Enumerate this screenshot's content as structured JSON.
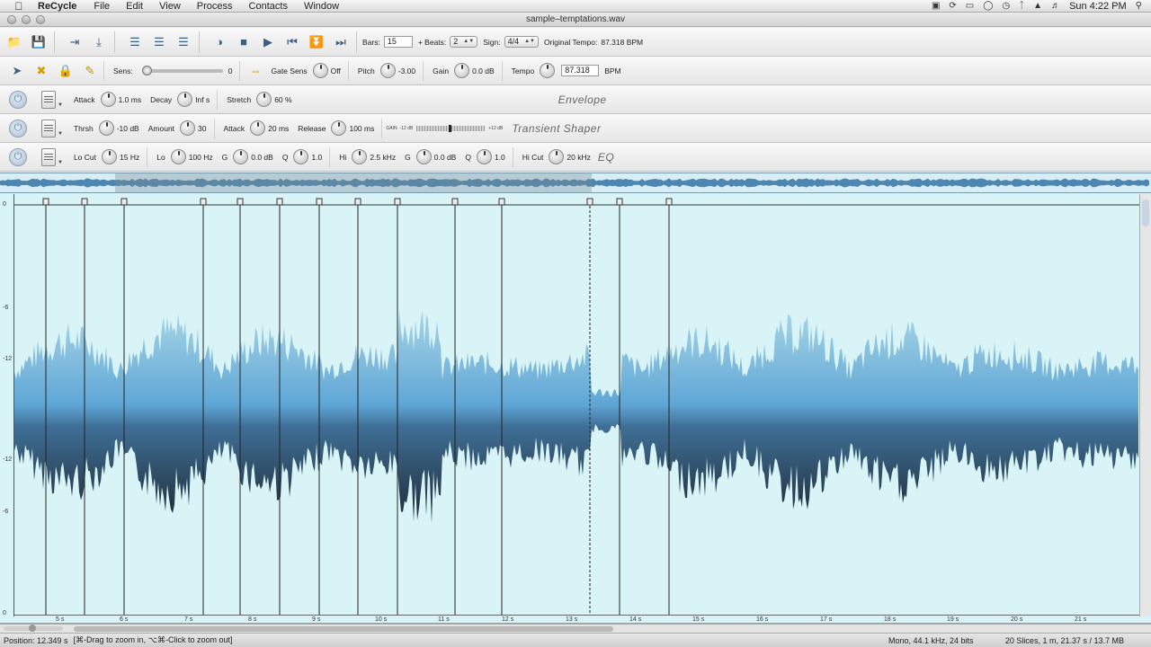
{
  "menubar": {
    "app_name": "ReCycle",
    "menus": [
      "File",
      "Edit",
      "View",
      "Process",
      "Contacts",
      "Window"
    ],
    "clock": "Sun 4:22 PM"
  },
  "window": {
    "title": "sample–temptations.wav"
  },
  "toolbar": {
    "bars_label": "Bars:",
    "bars_value": "15",
    "beats_label": "+ Beats:",
    "beats_value": "2",
    "sign_label": "Sign:",
    "sign_value": "4/4",
    "orig_tempo_label": "Original Tempo:",
    "orig_tempo_value": "87.318 BPM"
  },
  "params": {
    "sens_label": "Sens:",
    "sens_value": "0",
    "sens_level": 0,
    "gate_label": "Gate Sens",
    "gate_value": "Off",
    "pitch_label": "Pitch",
    "pitch_value": "-3.00",
    "gain_label": "Gain",
    "gain_value": "0.0 dB",
    "tempo_label": "Tempo",
    "tempo_value": "87.318",
    "tempo_unit": "BPM"
  },
  "envelope": {
    "attack_label": "Attack",
    "attack_value": "1.0 ms",
    "decay_label": "Decay",
    "decay_value": "Inf s",
    "stretch_label": "Stretch",
    "stretch_value": "60 %",
    "title": "Envelope"
  },
  "transient": {
    "thrsh_label": "Thrsh",
    "thrsh_value": "-10 dB",
    "amount_label": "Amount",
    "amount_value": "30",
    "attack_label": "Attack",
    "attack_value": "20 ms",
    "release_label": "Release",
    "release_value": "100 ms",
    "gain_tag": "GAIN",
    "meter_min": "-12 dB",
    "meter_max": "+12 dB",
    "title": "Transient Shaper"
  },
  "eq": {
    "locut_label": "Lo Cut",
    "locut_value": "15 Hz",
    "lo_label": "Lo",
    "lo_value": "100 Hz",
    "g1_label": "G",
    "g1_value": "0.0 dB",
    "q1_label": "Q",
    "q1_value": "1.0",
    "hi_label": "Hi",
    "hi_value": "2.5 kHz",
    "g2_label": "G",
    "g2_value": "0.0 dB",
    "q2_label": "Q",
    "q2_value": "1.0",
    "hicut_label": "Hi Cut",
    "hicut_value": "20 kHz",
    "title": "EQ"
  },
  "db_scale": [
    "0",
    "-6",
    "-12",
    "-12",
    "-6",
    "0"
  ],
  "time_ruler": [
    "5 s",
    "6 s",
    "7 s",
    "8 s",
    "9 s",
    "10 s",
    "11 s",
    "12 s",
    "13 s",
    "14 s",
    "15 s",
    "16 s",
    "17 s",
    "18 s",
    "19 s",
    "20 s",
    "21 s"
  ],
  "status": {
    "position": "Position: 12.349 s",
    "hint": "[⌘-Drag to zoom in, ⌥⌘-Click to zoom out]",
    "format": "Mono, 44.1 kHz, 24 bits",
    "info": "20 Slices, 1 m, 21.37 s / 13.7 MB"
  },
  "colors": {
    "wave_bg": "#d9f4f7",
    "wave_light": "#7fb6d8",
    "wave_dark": "#22323f",
    "accent": "#3a5f86"
  }
}
